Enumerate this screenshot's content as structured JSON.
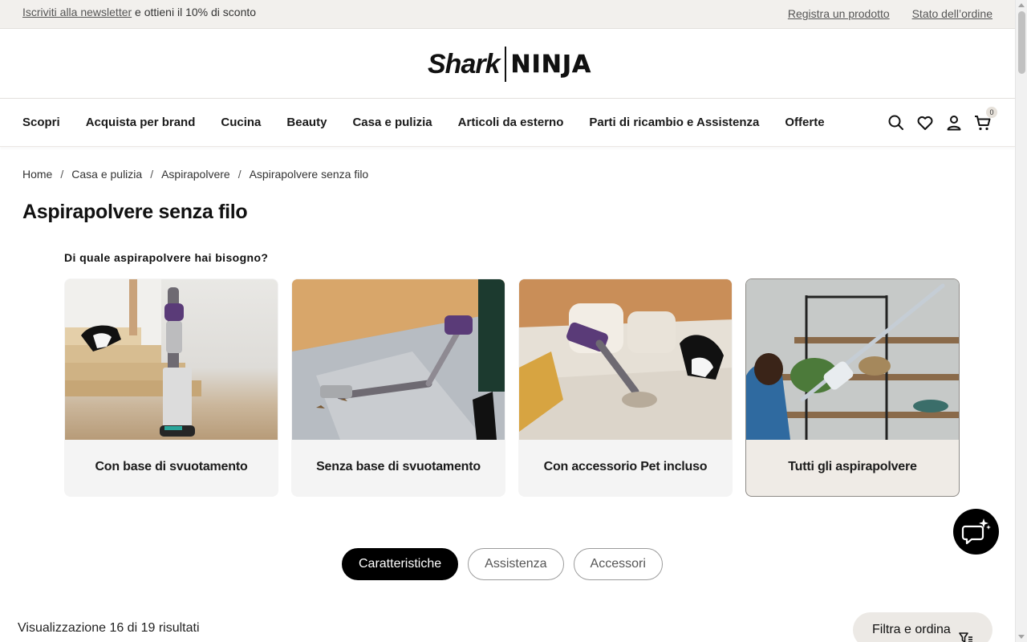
{
  "promo": {
    "newsletter_link": "Iscriviti alla newsletter",
    "newsletter_text": " e ottieni il 10% di sconto",
    "links": [
      "Registra un prodotto",
      "Stato dell’ordine"
    ]
  },
  "logo": {
    "left": "Shark",
    "right": "NINJA"
  },
  "nav": {
    "items": [
      "Scopri",
      "Acquista per brand",
      "Cucina",
      "Beauty",
      "Casa e pulizia",
      "Articoli da esterno",
      "Parti di ricambio e Assistenza",
      "Offerte"
    ],
    "icons": [
      "search-icon",
      "heart-icon",
      "account-icon",
      "cart-icon"
    ],
    "cart_count": "0"
  },
  "breadcrumb": [
    "Home",
    "Casa e pulizia",
    "Aspirapolvere",
    "Aspirapolvere senza filo"
  ],
  "page_title": "Aspirapolvere senza filo",
  "question": "Di quale aspirapolvere hai bisogno?",
  "cards": [
    {
      "label": "Con base di svuotamento"
    },
    {
      "label": "Senza base di svuotamento"
    },
    {
      "label": "Con accessorio Pet incluso"
    },
    {
      "label": "Tutti gli aspirapolvere"
    }
  ],
  "tabs": [
    {
      "label": "Caratteristiche",
      "active": true
    },
    {
      "label": "Assistenza",
      "active": false
    },
    {
      "label": "Accessori",
      "active": false
    }
  ],
  "results_text": "Visualizzazione 16 di 19 risultati",
  "filter_label": "Filtra e ordina",
  "colors": {
    "promo_bg": "#f2f0ed",
    "tab_active": "#000000",
    "card_bg": "#f4f4f4",
    "card_selected_bg": "#efebe6"
  }
}
